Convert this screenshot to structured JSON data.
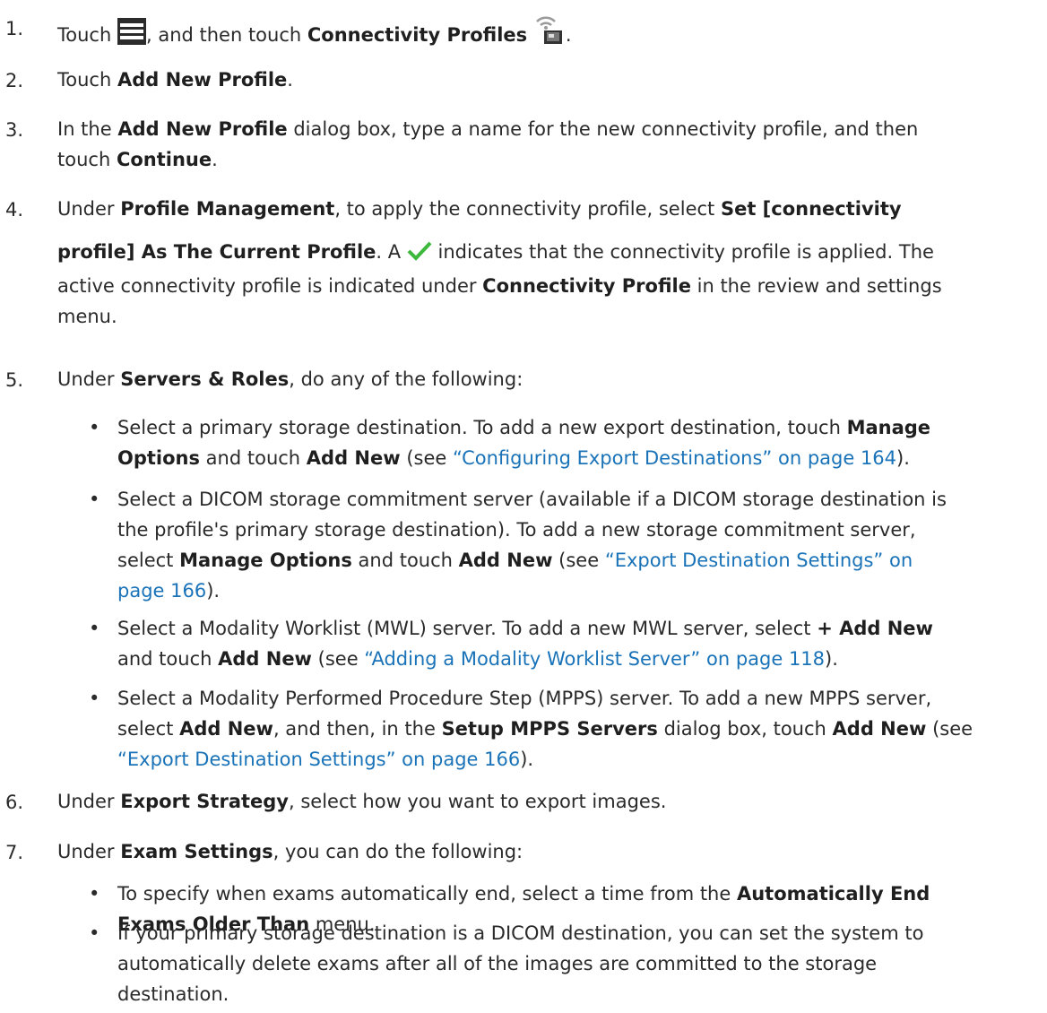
{
  "steps": [
    {
      "num": "1.",
      "pre": "Touch",
      "mid": ", and then touch ",
      "bold": "Connectivity Profiles",
      "post": ".",
      "icons": [
        "menu-icon",
        "connectivity-profile-icon"
      ]
    },
    {
      "num": "2.",
      "pre": "Touch ",
      "bold": "Add New Profile",
      "post": "."
    },
    {
      "num": "3.",
      "l1a": "In the ",
      "l1b": "Add New Profile",
      "l1c": " dialog box, type a name for the new connectivity profile, and then",
      "l2a": "touch ",
      "l2b": "Continue",
      "l2c": "."
    },
    {
      "num": "4.",
      "l1a": "Under ",
      "l1b": "Profile Management",
      "l1c": ", to apply the connectivity profile, select ",
      "l1d": "Set [connectivity",
      "l2a": "profile] As The Current Profile",
      "l2b": ". A ",
      "l2c": " indicates that the connectivity profile is applied. The",
      "l3": "active connectivity profile is indicated under ",
      "l3b": "Connectivity Profile",
      "l3c": " in the review and settings",
      "l4": "menu.",
      "icons": [
        "checkmark-icon"
      ]
    },
    {
      "num": "5.",
      "pre": "Under ",
      "bold": "Servers & Roles",
      "post": ", do any of the following:"
    },
    {
      "num": "6.",
      "pre": "Under ",
      "bold": "Export Strategy",
      "post": ", select how you want to export images."
    },
    {
      "num": "7.",
      "pre": "Under ",
      "bold": "Exam Settings",
      "post": ", you can do the following:"
    }
  ],
  "bullets5": [
    {
      "l1a": "Select a primary storage destination. To add a new export destination, touch ",
      "l1b": "Manage",
      "l2a": "Options",
      "l2b": " and touch ",
      "l2c": "Add New",
      "l2d": " (see ",
      "l2e": "“Configuring Export Destinations” on page 164",
      "l2f": ")."
    },
    {
      "l1": "Select a DICOM storage commitment server (available if a DICOM storage destination is",
      "l2": "the profile's primary storage destination). To add a new storage commitment server,",
      "l3a": "select ",
      "l3b": "Manage Options",
      "l3c": " and touch ",
      "l3d": "Add New",
      "l3e": " (see ",
      "l3f": "“Export Destination Settings” on",
      "l4a": "page 166",
      "l4b": ")."
    },
    {
      "l1a": "Select a Modality Worklist (MWL) server. To add a new MWL server, select ",
      "l1b": "+ Add New",
      "l2a": "and touch ",
      "l2b": "Add New",
      "l2c": " (see ",
      "l2d": "“Adding a Modality Worklist Server” on page 118",
      "l2e": ")."
    },
    {
      "l1": "Select a Modality Performed Procedure Step (MPPS) server. To add a new MPPS server,",
      "l2a": "select ",
      "l2b": "Add New",
      "l2c": ", and then, in the ",
      "l2d": "Setup MPPS Servers",
      "l2e": " dialog box, touch ",
      "l2f": "Add New",
      "l2g": " (see",
      "l3a": "“Export Destination Settings” on page 166",
      "l3b": ")."
    }
  ],
  "bullets7": [
    {
      "l1a": "To specify when exams automatically end, select a time from the ",
      "l1b": "Automatically End",
      "l2a": "Exams Older Than",
      "l2b": " menu."
    },
    {
      "l1": "If your primary storage destination is a DICOM destination, you can set the system to",
      "l2": "automatically delete exams after all of the images are committed to the storage",
      "l3": "destination."
    }
  ],
  "bullet_char": "•",
  "colors": {
    "text": "#2a2a2a",
    "link": "#1a73b8",
    "check": "#3cb83c"
  }
}
